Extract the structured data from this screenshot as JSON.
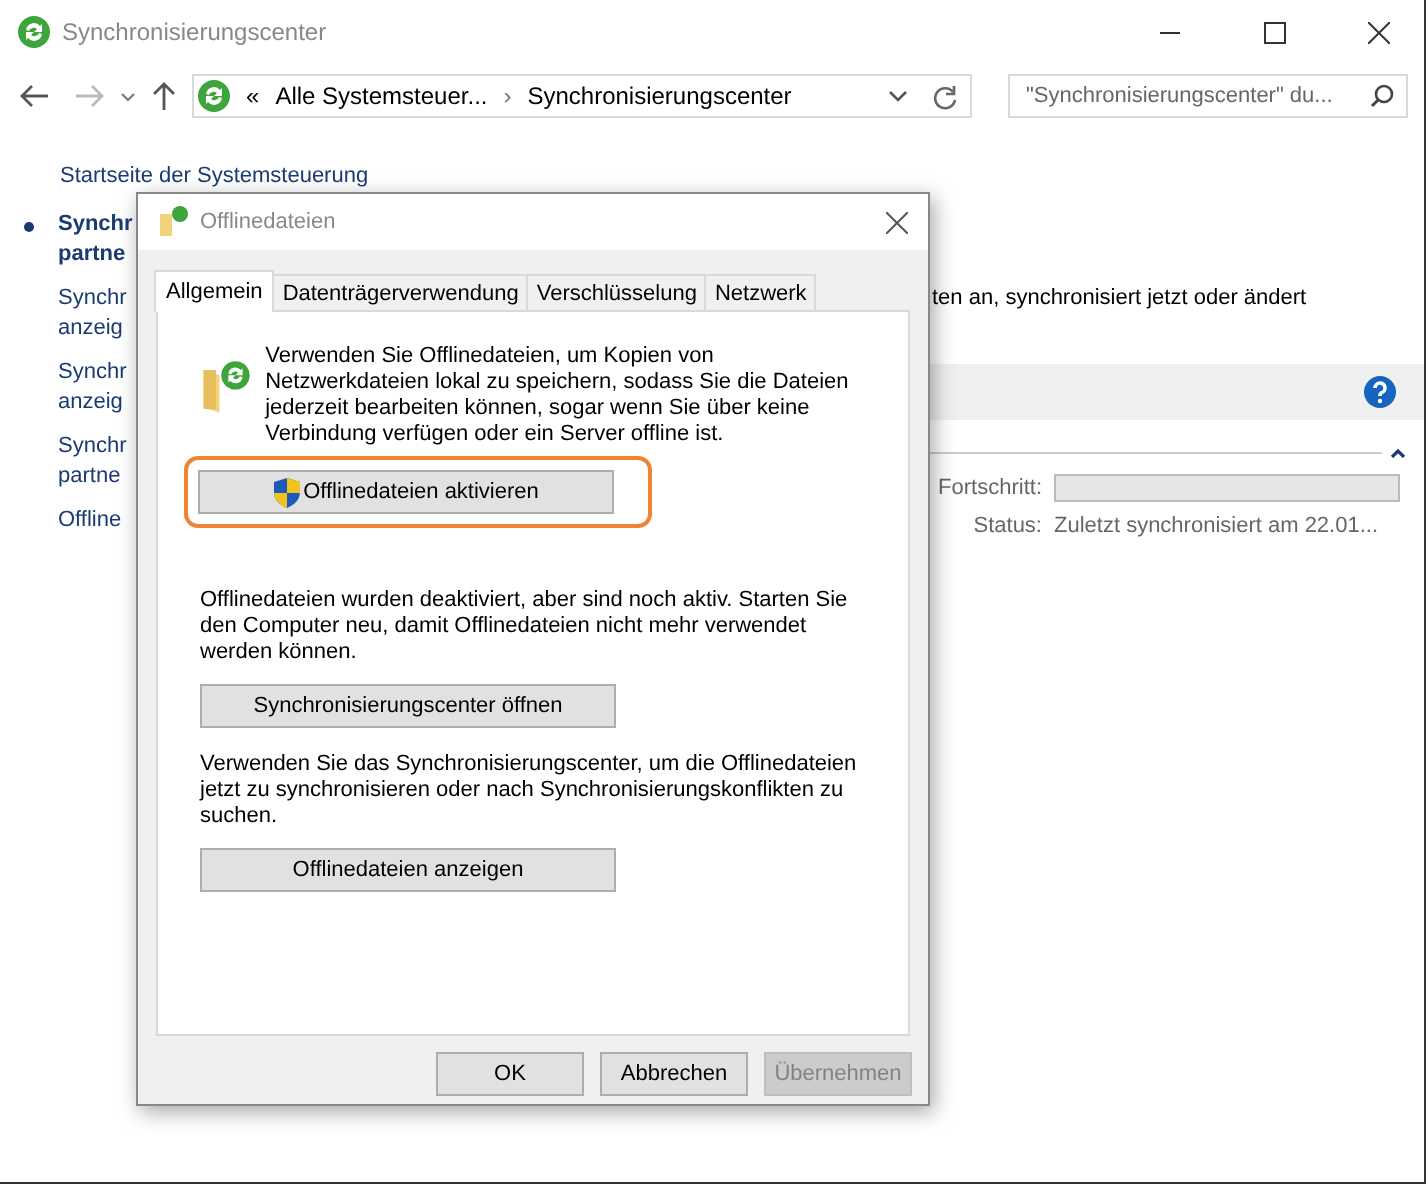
{
  "window": {
    "title": "Synchronisierungscenter"
  },
  "address": {
    "overflow": "«",
    "separator": "›",
    "crumbs": [
      "Alle Systemsteuer...",
      "Synchronisierungscenter"
    ],
    "search_placeholder": "\"Synchronisierungscenter\" du..."
  },
  "sidebar": {
    "home": "Startseite der Systemsteuerung",
    "items": [
      {
        "lines": [
          "Synchr",
          "partne"
        ],
        "selected": true
      },
      {
        "lines": [
          "Synchr",
          "anzeig"
        ],
        "selected": false
      },
      {
        "lines": [
          "Synchr",
          "anzeig"
        ],
        "selected": false
      },
      {
        "lines": [
          "Synchr",
          "partne"
        ],
        "selected": false
      },
      {
        "lines": [
          "Offline"
        ],
        "selected": false
      }
    ]
  },
  "content": {
    "description": "ten an, synchronisiert jetzt oder ändert",
    "progress": {
      "label": "Fortschritt:",
      "level": 0
    },
    "status": {
      "label": "Status:",
      "value": "Zuletzt synchronisiert am 22.01..."
    }
  },
  "dialog": {
    "title": "Offlinedateien",
    "tabs": [
      {
        "label": "Allgemein",
        "selected": true
      },
      {
        "label": "Datenträgerverwendung",
        "selected": false
      },
      {
        "label": "Verschlüsselung",
        "selected": false
      },
      {
        "label": "Netzwerk",
        "selected": false
      }
    ],
    "intro": "Verwenden Sie Offlinedateien, um Kopien von Netzwerkdateien lokal zu speichern, sodass Sie die Dateien jederzeit bearbeiten können, sogar wenn Sie über keine Verbindung verfügen oder ein Server offline ist.",
    "sections": [
      {
        "button": "Offlinedateien aktivieren",
        "shield": true,
        "highlighted": true
      },
      {
        "text": "Offlinedateien wurden deaktiviert, aber sind noch aktiv. Starten Sie den Computer neu, damit Offlinedateien nicht mehr verwendet werden können.",
        "button": "Synchronisierungscenter öffnen",
        "shield": false,
        "highlighted": false
      },
      {
        "text": "Verwenden Sie das Synchronisierungscenter, um die Offlinedateien jetzt zu synchronisieren oder nach Synchronisierungskonflikten zu suchen.",
        "button": "Offlinedateien anzeigen",
        "shield": false,
        "highlighted": false
      }
    ],
    "footer": [
      {
        "label": "OK",
        "disabled": false
      },
      {
        "label": "Abbrechen",
        "disabled": false
      },
      {
        "label": "Übernehmen",
        "disabled": true
      }
    ]
  }
}
